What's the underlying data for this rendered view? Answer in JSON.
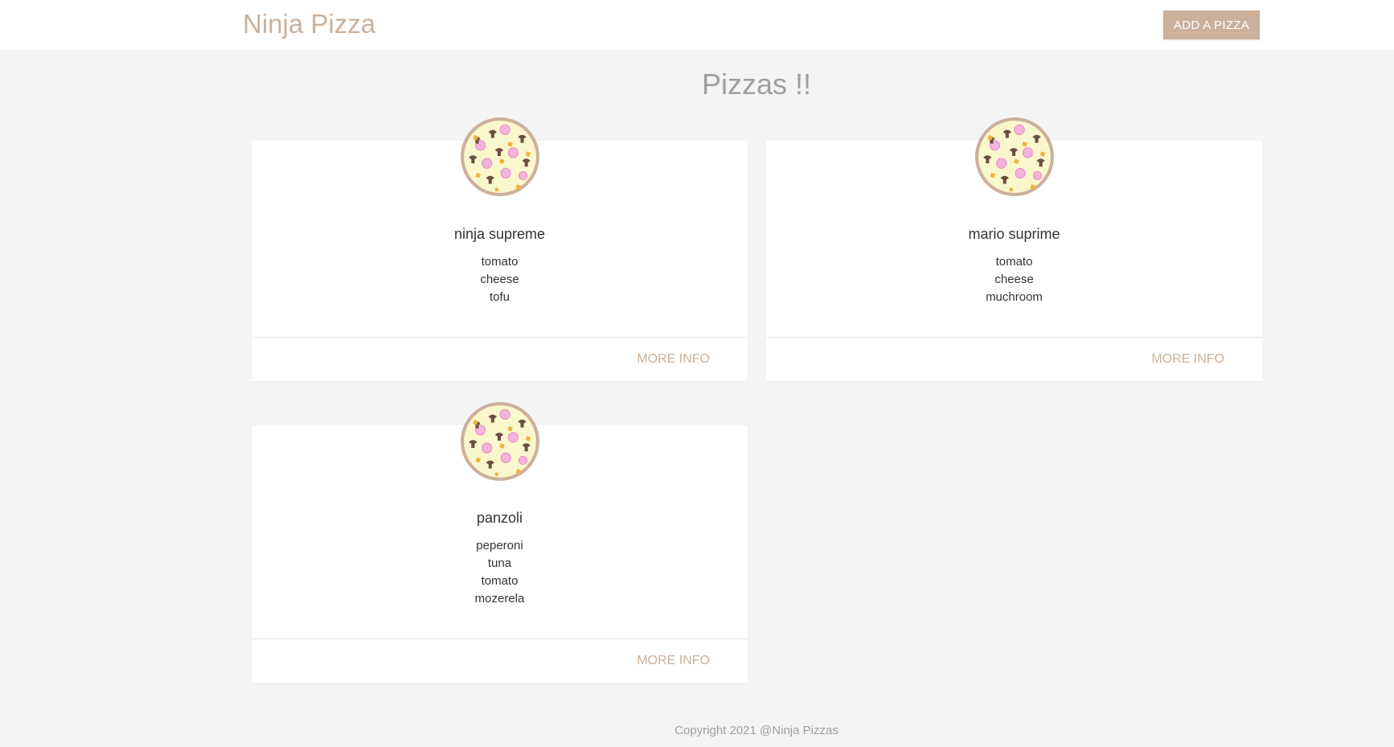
{
  "navbar": {
    "brand": "Ninja Pizza",
    "add_button": "ADD A PIZZA"
  },
  "main": {
    "title": "Pizzas !!",
    "pizzas": [
      {
        "name": "ninja supreme",
        "ingredients": [
          "tomato",
          "cheese",
          "tofu"
        ],
        "action": "MORE INFO"
      },
      {
        "name": "mario suprime",
        "ingredients": [
          "tomato",
          "cheese",
          "muchroom"
        ],
        "action": "MORE INFO"
      },
      {
        "name": "panzoli",
        "ingredients": [
          "peperoni",
          "tuna",
          "tomato",
          "mozerela"
        ],
        "action": "MORE INFO"
      }
    ]
  },
  "footer": {
    "copyright": "Copyright 2021 @Ninja Pizzas"
  },
  "colors": {
    "brand": "#cbb09c",
    "background": "#f4f4f4",
    "card": "#ffffff"
  },
  "icons": {
    "pizza": "pizza-icon"
  }
}
